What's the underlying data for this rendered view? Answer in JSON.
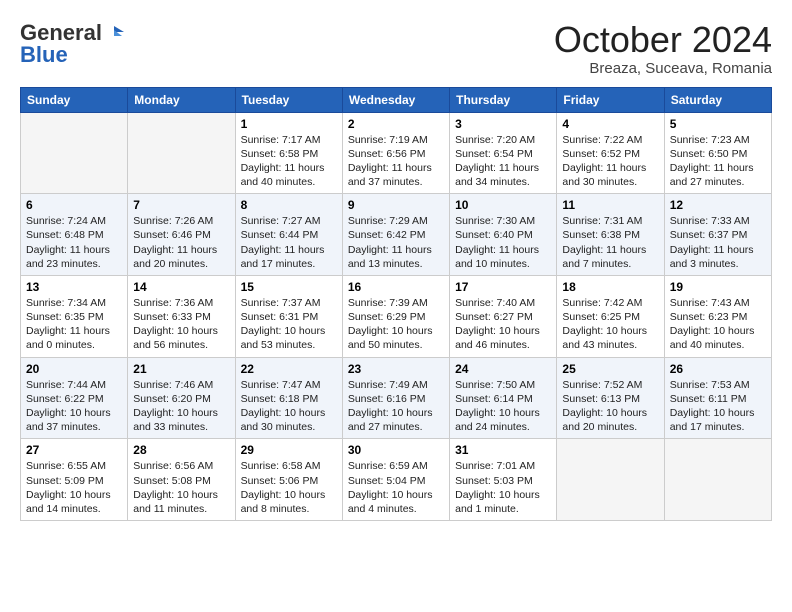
{
  "logo": {
    "general": "General",
    "blue": "Blue"
  },
  "title": "October 2024",
  "location": "Breaza, Suceava, Romania",
  "headers": [
    "Sunday",
    "Monday",
    "Tuesday",
    "Wednesday",
    "Thursday",
    "Friday",
    "Saturday"
  ],
  "weeks": [
    [
      {
        "day": "",
        "text": ""
      },
      {
        "day": "",
        "text": ""
      },
      {
        "day": "1",
        "text": "Sunrise: 7:17 AM\nSunset: 6:58 PM\nDaylight: 11 hours and 40 minutes."
      },
      {
        "day": "2",
        "text": "Sunrise: 7:19 AM\nSunset: 6:56 PM\nDaylight: 11 hours and 37 minutes."
      },
      {
        "day": "3",
        "text": "Sunrise: 7:20 AM\nSunset: 6:54 PM\nDaylight: 11 hours and 34 minutes."
      },
      {
        "day": "4",
        "text": "Sunrise: 7:22 AM\nSunset: 6:52 PM\nDaylight: 11 hours and 30 minutes."
      },
      {
        "day": "5",
        "text": "Sunrise: 7:23 AM\nSunset: 6:50 PM\nDaylight: 11 hours and 27 minutes."
      }
    ],
    [
      {
        "day": "6",
        "text": "Sunrise: 7:24 AM\nSunset: 6:48 PM\nDaylight: 11 hours and 23 minutes."
      },
      {
        "day": "7",
        "text": "Sunrise: 7:26 AM\nSunset: 6:46 PM\nDaylight: 11 hours and 20 minutes."
      },
      {
        "day": "8",
        "text": "Sunrise: 7:27 AM\nSunset: 6:44 PM\nDaylight: 11 hours and 17 minutes."
      },
      {
        "day": "9",
        "text": "Sunrise: 7:29 AM\nSunset: 6:42 PM\nDaylight: 11 hours and 13 minutes."
      },
      {
        "day": "10",
        "text": "Sunrise: 7:30 AM\nSunset: 6:40 PM\nDaylight: 11 hours and 10 minutes."
      },
      {
        "day": "11",
        "text": "Sunrise: 7:31 AM\nSunset: 6:38 PM\nDaylight: 11 hours and 7 minutes."
      },
      {
        "day": "12",
        "text": "Sunrise: 7:33 AM\nSunset: 6:37 PM\nDaylight: 11 hours and 3 minutes."
      }
    ],
    [
      {
        "day": "13",
        "text": "Sunrise: 7:34 AM\nSunset: 6:35 PM\nDaylight: 11 hours and 0 minutes."
      },
      {
        "day": "14",
        "text": "Sunrise: 7:36 AM\nSunset: 6:33 PM\nDaylight: 10 hours and 56 minutes."
      },
      {
        "day": "15",
        "text": "Sunrise: 7:37 AM\nSunset: 6:31 PM\nDaylight: 10 hours and 53 minutes."
      },
      {
        "day": "16",
        "text": "Sunrise: 7:39 AM\nSunset: 6:29 PM\nDaylight: 10 hours and 50 minutes."
      },
      {
        "day": "17",
        "text": "Sunrise: 7:40 AM\nSunset: 6:27 PM\nDaylight: 10 hours and 46 minutes."
      },
      {
        "day": "18",
        "text": "Sunrise: 7:42 AM\nSunset: 6:25 PM\nDaylight: 10 hours and 43 minutes."
      },
      {
        "day": "19",
        "text": "Sunrise: 7:43 AM\nSunset: 6:23 PM\nDaylight: 10 hours and 40 minutes."
      }
    ],
    [
      {
        "day": "20",
        "text": "Sunrise: 7:44 AM\nSunset: 6:22 PM\nDaylight: 10 hours and 37 minutes."
      },
      {
        "day": "21",
        "text": "Sunrise: 7:46 AM\nSunset: 6:20 PM\nDaylight: 10 hours and 33 minutes."
      },
      {
        "day": "22",
        "text": "Sunrise: 7:47 AM\nSunset: 6:18 PM\nDaylight: 10 hours and 30 minutes."
      },
      {
        "day": "23",
        "text": "Sunrise: 7:49 AM\nSunset: 6:16 PM\nDaylight: 10 hours and 27 minutes."
      },
      {
        "day": "24",
        "text": "Sunrise: 7:50 AM\nSunset: 6:14 PM\nDaylight: 10 hours and 24 minutes."
      },
      {
        "day": "25",
        "text": "Sunrise: 7:52 AM\nSunset: 6:13 PM\nDaylight: 10 hours and 20 minutes."
      },
      {
        "day": "26",
        "text": "Sunrise: 7:53 AM\nSunset: 6:11 PM\nDaylight: 10 hours and 17 minutes."
      }
    ],
    [
      {
        "day": "27",
        "text": "Sunrise: 6:55 AM\nSunset: 5:09 PM\nDaylight: 10 hours and 14 minutes."
      },
      {
        "day": "28",
        "text": "Sunrise: 6:56 AM\nSunset: 5:08 PM\nDaylight: 10 hours and 11 minutes."
      },
      {
        "day": "29",
        "text": "Sunrise: 6:58 AM\nSunset: 5:06 PM\nDaylight: 10 hours and 8 minutes."
      },
      {
        "day": "30",
        "text": "Sunrise: 6:59 AM\nSunset: 5:04 PM\nDaylight: 10 hours and 4 minutes."
      },
      {
        "day": "31",
        "text": "Sunrise: 7:01 AM\nSunset: 5:03 PM\nDaylight: 10 hours and 1 minute."
      },
      {
        "day": "",
        "text": ""
      },
      {
        "day": "",
        "text": ""
      }
    ]
  ]
}
